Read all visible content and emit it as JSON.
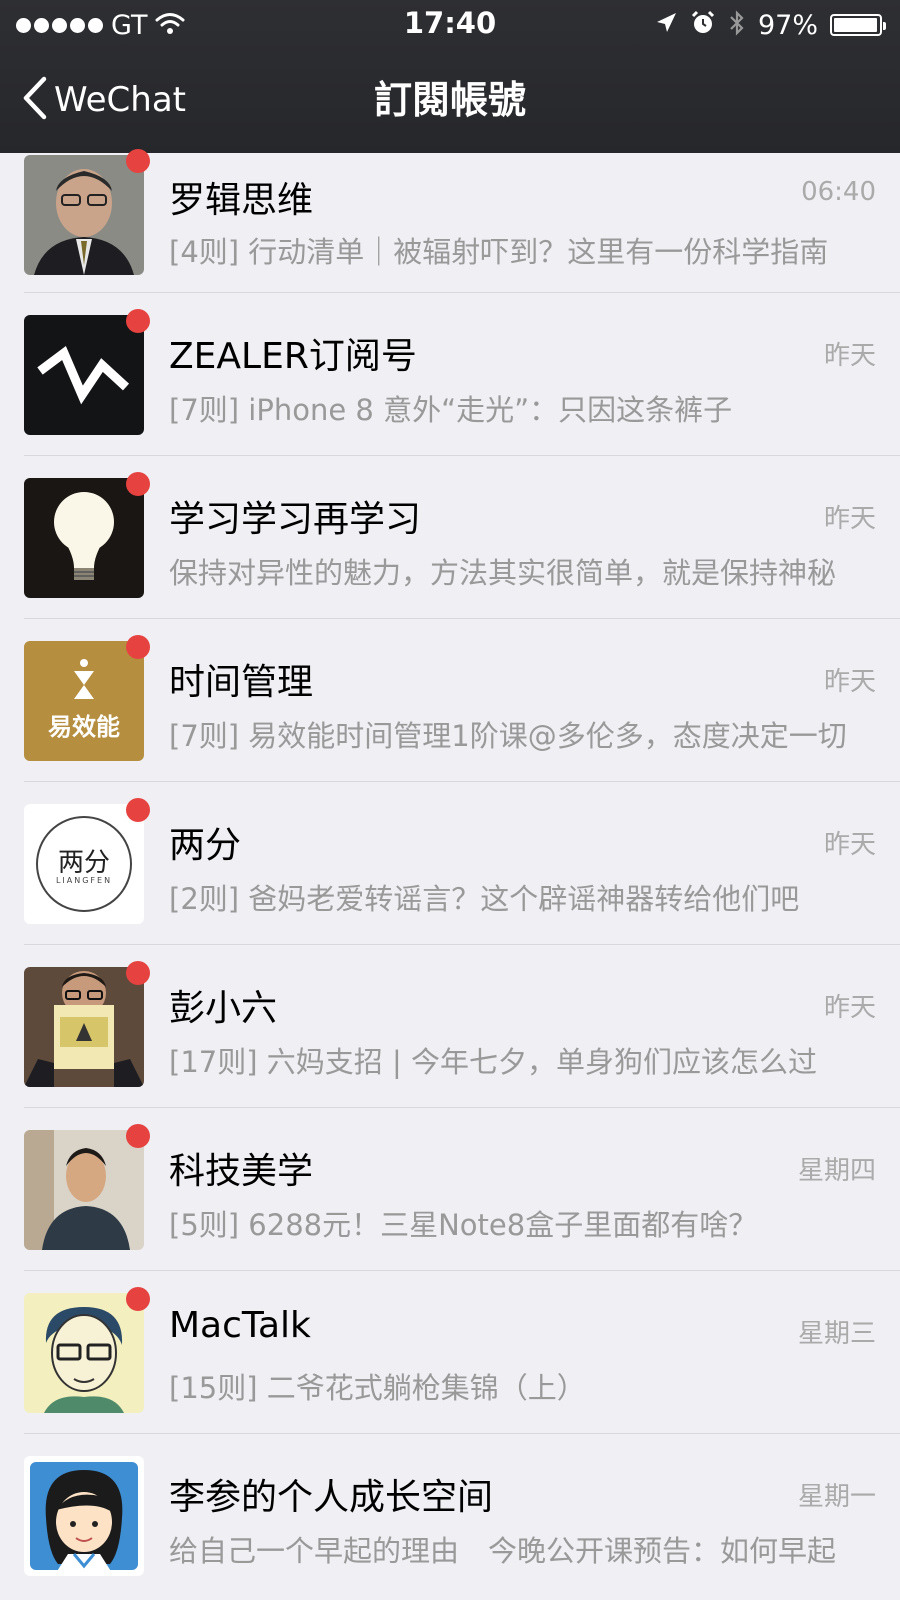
{
  "status_bar": {
    "carrier": "GT",
    "time": "17:40",
    "battery": "97%",
    "battery_level": 0.97,
    "icons": [
      "signal-dots-icon",
      "wifi-icon",
      "location-arrow-icon",
      "alarm-icon",
      "bluetooth-icon",
      "battery-icon"
    ]
  },
  "nav": {
    "back_label": "WeChat",
    "title": "訂閱帳號"
  },
  "colors": {
    "header_bg": "#2e2f33",
    "badge": "#e64340",
    "background": "#efeff4"
  },
  "accounts": [
    {
      "name": "罗辑思维",
      "time": "06:40",
      "preview": "[4则] 行动清单｜被辐射吓到？这里有一份科学指南"
    },
    {
      "name": "ZEALER订阅号",
      "time": "昨天",
      "preview": "[7则] iPhone 8 意外“走光”：只因这条裤子"
    },
    {
      "name": "学习学习再学习",
      "time": "昨天",
      "preview": "保持对异性的魅力，方法其实很简单，就是保持神秘"
    },
    {
      "name": "时间管理",
      "time": "昨天",
      "preview": "[7则] 易效能时间管理1阶课@多伦多，态度决定一切"
    },
    {
      "name": "两分",
      "time": "昨天",
      "preview": "[2则] 爸妈老爱转谣言？这个辟谣神器转给他们吧"
    },
    {
      "name": "彭小六",
      "time": "昨天",
      "preview": "[17则] 六妈支招 | 今年七夕，单身狗们应该怎么过"
    },
    {
      "name": "科技美学",
      "time": "星期四",
      "preview": "[5则] 6288元！三星Note8盒子里面都有啥？"
    },
    {
      "name": "MacTalk",
      "time": "星期三",
      "preview": "[15则] 二爷花式躺枪集锦（上）"
    },
    {
      "name": "李参的个人成长空间",
      "time": "星期一",
      "preview": "给自己一个早起的理由　今晚公开课预告：如何早起"
    }
  ],
  "logos": {
    "shijian": "易效能",
    "liangfen_main": "两分",
    "liangfen_sub": "LIANGFEN"
  }
}
